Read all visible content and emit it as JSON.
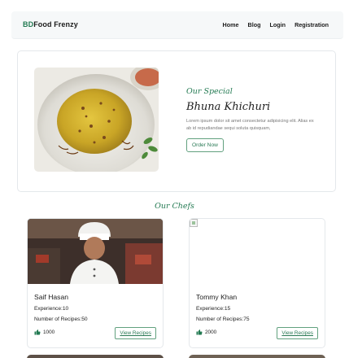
{
  "navbar": {
    "brand_accent": "BD",
    "brand_rest": "Food Frenzy",
    "links": [
      "Home",
      "Blog",
      "Login",
      "Registration"
    ]
  },
  "special": {
    "label": "Our Special",
    "title": "Bhuna Khichuri",
    "description": "Lorem ipsum dolor sit amet consectetur adipisicing elit. Alias ex ab id repudiandae sequi soluta quisquam,",
    "button": "Order Now",
    "image_icon": "food-plate-image"
  },
  "chefs": {
    "title": "Our Chefs",
    "items": [
      {
        "name": "Saif Hasan",
        "experience": "Experience:10",
        "recipes": "Number of Recipes:50",
        "likes": "1000",
        "button": "View Recipes",
        "photo": "chef-photo"
      },
      {
        "name": "Tommy Khan",
        "experience": "Experience:15",
        "recipes": "Number of Recipes:75",
        "likes": "2000",
        "button": "View Recipes",
        "photo": "broken-image"
      }
    ]
  },
  "colors": {
    "accent": "#237a52",
    "navbar_bg": "#f6f8f9",
    "card_border": "#e4e8eb"
  }
}
